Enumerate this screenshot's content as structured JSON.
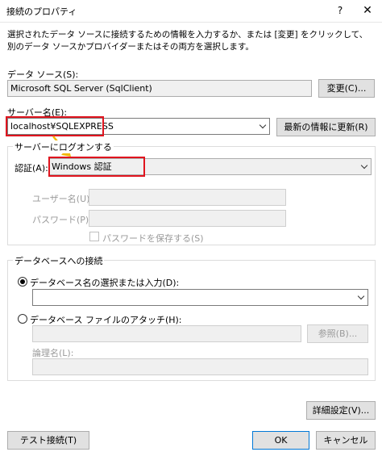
{
  "window": {
    "title": "接続のプロパティ",
    "help": "?",
    "close": "✕"
  },
  "description": "選択されたデータ ソースに接続するための情報を入力するか、または [変更] をクリックして、別のデータ ソースかプロバイダーまたはその両方を選択します。",
  "data_source": {
    "label": "データ ソース(S):",
    "value": "Microsoft SQL Server (SqlClient)",
    "change_button": "変更(C)..."
  },
  "server": {
    "label": "サーバー名(E):",
    "value": "localhost¥SQLEXPRESS",
    "refresh_button": "最新の情報に更新(R)"
  },
  "logon": {
    "group_title": "サーバーにログオンする",
    "auth_label": "認証(A):",
    "auth_value": "Windows 認証",
    "user_label": "ユーザー名(U):",
    "password_label": "パスワード(P):",
    "save_password_label": "パスワードを保存する(S)"
  },
  "database": {
    "group_title": "データベースへの接続",
    "select_radio_label": "データベース名の選択または入力(D):",
    "select_value": "",
    "attach_radio_label": "データベース ファイルのアタッチ(H):",
    "browse_button": "参照(B)...",
    "logical_name_label": "論理名(L):"
  },
  "advanced_button": "詳細設定(V)...",
  "test_button": "テスト接続(T)",
  "ok_button": "OK",
  "cancel_button": "キャンセル",
  "colors": {
    "highlight_red": "#e0141e",
    "arrow_yellow": "#f2b705",
    "default_button_border": "#0078d7"
  }
}
